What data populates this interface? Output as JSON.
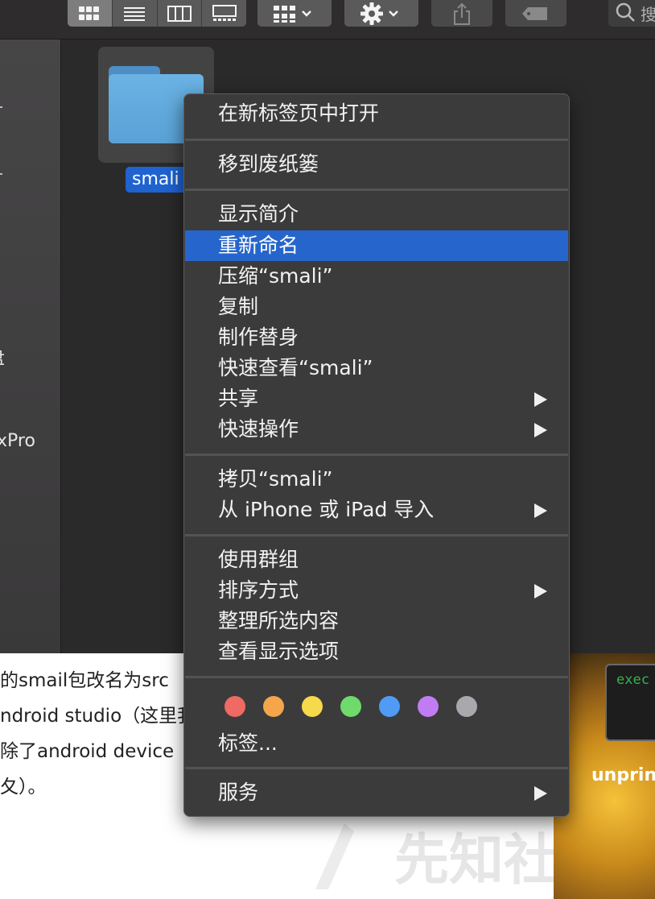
{
  "toolbar": {
    "view_icons": [
      "icon-view-icon",
      "list-view-icon",
      "column-view-icon",
      "gallery-view-icon"
    ],
    "group_icon": "grid-group-icon",
    "action_icon": "gear-icon",
    "share_icon": "share-icon",
    "tag_icon": "tag-icon",
    "search_glyph": "🔍",
    "search_partial": "搜"
  },
  "sidebar": {
    "partial_items": [
      "盘",
      "xPro"
    ]
  },
  "file": {
    "name": "smali"
  },
  "web_content": {
    "lines": [
      "的smail包改名为src",
      "ndroid studio（这里我",
      "除了android device",
      "夂）。"
    ],
    "watermark": "先知社区"
  },
  "photo": {
    "terminal_text": "exec",
    "caption": "unprin"
  },
  "context_menu": {
    "open_in_new_tab": "在新标签页中打开",
    "move_to_trash": "移到废纸篓",
    "get_info": "显示简介",
    "rename": "重新命名",
    "compress": "压缩“smali”",
    "duplicate": "复制",
    "make_alias": "制作替身",
    "quick_look": "快速查看“smali”",
    "share": "共享",
    "quick_actions": "快速操作",
    "copy": "拷贝“smali”",
    "import_from_iphone": "从 iPhone 或 iPad 导入",
    "use_groups": "使用群组",
    "sort_by": "排序方式",
    "clean_up_selection": "整理所选内容",
    "show_view_options": "查看显示选项",
    "tags": "标签...",
    "services": "服务",
    "tag_colors": [
      "#ee6a63",
      "#f5a54a",
      "#f7d94c",
      "#6fdb6a",
      "#4f9bf5",
      "#c17cf3",
      "#a9a8ad"
    ]
  }
}
